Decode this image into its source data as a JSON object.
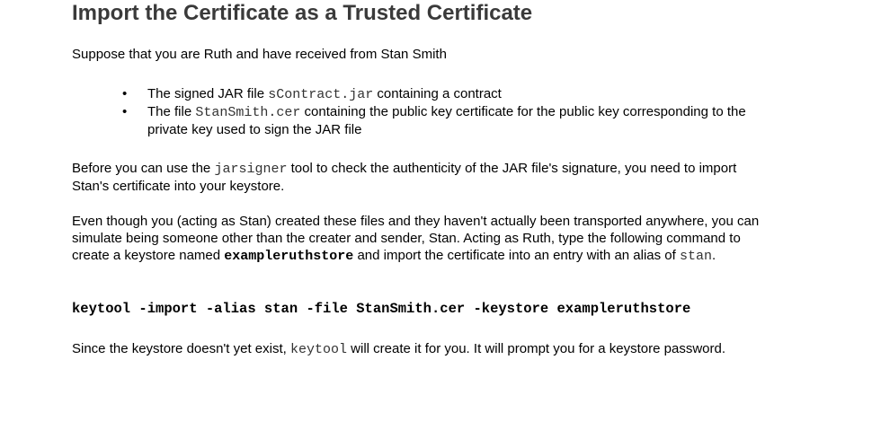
{
  "title": "Import the Certificate as a Trusted Certificate",
  "intro": "Suppose that you are Ruth and have received from Stan Smith",
  "bullets": [
    {
      "pre": "The signed JAR file ",
      "code": "sContract.jar",
      "post": " containing a contract"
    },
    {
      "pre": "The file ",
      "code": "StanSmith.cer",
      "post": " containing the public key certificate for the public key corresponding to the private key used to sign the JAR file"
    }
  ],
  "para1": {
    "pre": "Before you can use the ",
    "code": "jarsigner",
    "post": " tool to check the authenticity of the JAR file's signature, you need to import Stan's certificate into your keystore."
  },
  "para2": {
    "pre": "Even though you (acting as Stan) created these files and they haven't actually been transported anywhere, you can simulate being someone other than the creater and sender, Stan. Acting as Ruth, type the following command to create a keystore named ",
    "bold_code": "exampleruthstore",
    "mid": " and import the certificate into an entry with an alias of ",
    "code": "stan",
    "post": "."
  },
  "command": "keytool -import -alias stan -file StanSmith.cer -keystore exampleruthstore",
  "para3": {
    "pre": "Since the keystore doesn't yet exist, ",
    "code": "keytool",
    "post": " will create it for you. It will prompt you for a keystore password."
  },
  "bullet_glyph": "•"
}
